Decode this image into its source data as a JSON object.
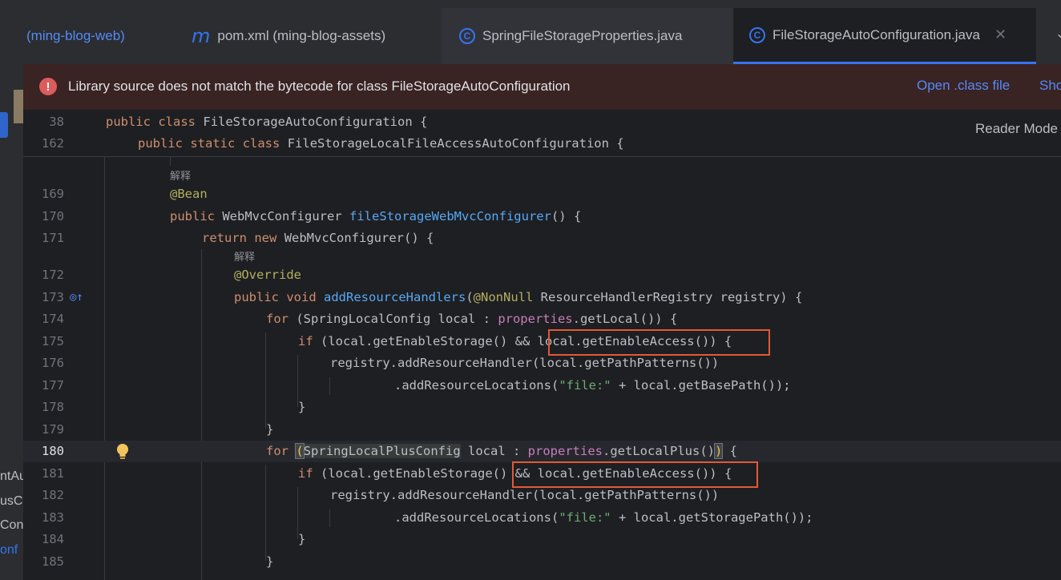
{
  "left_panel": {
    "fragments": [
      "ntAu",
      "usCo",
      "Con",
      "onf"
    ]
  },
  "tabs": {
    "web": "(ming-blog-web)",
    "pom": "pom.xml (ming-blog-assets)",
    "props": "SpringFileStorageProperties.java",
    "active": "FileStorageAutoConfiguration.java",
    "close": "✕",
    "chevron": "⌄",
    "icon_c": "C",
    "icon_m": "m"
  },
  "warning": {
    "icon": "!",
    "text": "Library source does not match the bytecode for class FileStorageAutoConfiguration",
    "open_class": "Open .class file",
    "show": "Sho"
  },
  "editor": {
    "reader_mode": "Reader Mode",
    "sticky": [
      {
        "ln": "38"
      },
      {
        "ln": "162"
      }
    ],
    "lines": {
      "l169": "169",
      "l170": "170",
      "l171": "171",
      "l172": "172",
      "l173": "173",
      "l174": "174",
      "l175": "175",
      "l176": "176",
      "l177": "177",
      "l178": "178",
      "l179": "179",
      "l180": "180",
      "l181": "181",
      "l182": "182",
      "l183": "183",
      "l184": "184",
      "l185": "185"
    },
    "doc_hint": "解释",
    "tokens": {
      "public": "public",
      "class": "class",
      "static": "static",
      "return": "return",
      "new": "new",
      "void": "void",
      "for": "for",
      "if": "if",
      "cls_fsac": "FileStorageAutoConfiguration {",
      "cls_local": "FileStorageLocalFileAccessAutoConfiguration {",
      "bean": "@Bean",
      "override": "@Override",
      "nonnull": "@NonNull",
      "webmvc": "WebMvcConfigurer",
      "m_fswmc": "fileStorageWebMvcConfigurer",
      "paren_brace": "() {",
      "new_webmvc": "WebMvcConfigurer() {",
      "m_arh": "addResourceHandlers",
      "arh_rest": "ResourceHandlerRegistry registry) {",
      "for174_a": "(SpringLocalConfig local : ",
      "properties": "properties",
      "get_local": ".getLocal()) {",
      "if175_a": "(local.getEnableStorage() && ",
      "if_access": "local.getEnableAccess()) {",
      "registry_add": "registry.addResourceHandler(local.getPathPatterns())",
      "add_locs": ".addResourceLocations(",
      "file_str": "\"file:\"",
      "base_path": " + local.getBasePath());",
      "storage_path": " + local.getStoragePath());",
      "close_brace": "}",
      "for180_cls": "SpringLocalPlusConfig",
      "for180_local": " local : ",
      "get_local_plus": ".getLocalPlus()",
      "if181_a": "(local.getEnableStorage(",
      "if181_b": ") && local.getEnableAccess()) ",
      "lparen": "(",
      "rparen": ")",
      "lbrace": "{",
      "s_char": "S",
      "pringrest": "pringLocalPlusConfig"
    }
  }
}
